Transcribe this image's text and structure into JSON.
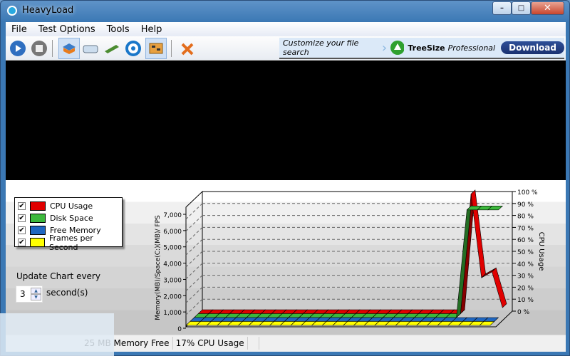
{
  "window": {
    "title": "HeavyLoad",
    "minimize": "–",
    "maximize": "□",
    "close": "✕"
  },
  "menu": [
    "File",
    "Test Options",
    "Tools",
    "Help"
  ],
  "toolbar": {
    "icons": [
      "play-icon",
      "stop-icon",
      "cpu-icon",
      "disk-icon",
      "memory-icon",
      "treesize-icon",
      "gpu-icon",
      "tools-icon"
    ],
    "active": [
      "cpu-icon",
      "gpu-icon"
    ]
  },
  "ad": {
    "text": "Customize your file search",
    "brand": "TreeSize",
    "brand_suffix": "Professional",
    "button": "Download"
  },
  "legend": [
    {
      "label": "CPU Usage",
      "color": "#e00000",
      "checked": true
    },
    {
      "label": "Disk Space",
      "color": "#3cb83c",
      "checked": true
    },
    {
      "label": "Free Memory",
      "color": "#1f66c0",
      "checked": true
    },
    {
      "label": "Frames per Second",
      "color": "#ffff00",
      "checked": true
    }
  ],
  "update": {
    "label": "Update Chart every",
    "value": "3",
    "unit": "second(s)"
  },
  "chart_data": {
    "type": "line",
    "3d": true,
    "left_axis": {
      "label": "Memory(MB)/Space(C:)(MB)/ FPS",
      "ticks": [
        "0",
        "1,000",
        "2,000",
        "3,000",
        "4,000",
        "5,000",
        "6,000",
        "7,000"
      ],
      "range": [
        0,
        7000
      ]
    },
    "right_axis": {
      "label": "CPU Usage",
      "ticks": [
        "0 %",
        "10 %",
        "20 %",
        "30 %",
        "40 %",
        "50 %",
        "60 %",
        "70 %",
        "80 %",
        "90 %",
        "100 %"
      ],
      "range": [
        0,
        100
      ]
    },
    "grid": true,
    "series": [
      {
        "name": "CPU Usage",
        "color": "#e00000",
        "values": [
          0,
          0,
          0,
          0,
          0,
          0,
          0,
          0,
          0,
          0,
          0,
          0,
          0,
          0,
          0,
          0,
          0,
          0,
          0,
          0,
          0,
          0,
          0,
          0,
          0,
          0,
          100,
          30,
          35,
          5
        ]
      },
      {
        "name": "Disk Space",
        "color": "#3cb83c",
        "values": [
          0,
          0,
          0,
          0,
          0,
          0,
          0,
          0,
          0,
          0,
          0,
          0,
          0,
          0,
          0,
          0,
          0,
          0,
          0,
          0,
          0,
          0,
          0,
          0,
          0,
          0,
          90,
          90,
          90,
          90
        ]
      },
      {
        "name": "Free Memory",
        "color": "#1f66c0",
        "values": [
          0,
          0,
          0,
          0,
          0,
          0,
          0,
          0,
          0,
          0,
          0,
          0,
          0,
          0,
          0,
          0,
          0,
          0,
          0,
          0,
          0,
          0,
          0,
          0,
          0,
          0,
          0,
          0,
          0,
          0
        ]
      },
      {
        "name": "Frames per Second",
        "color": "#ffff00",
        "values": [
          0,
          0,
          0,
          0,
          0,
          0,
          0,
          0,
          0,
          0,
          0,
          0,
          0,
          0,
          0,
          0,
          0,
          0,
          0,
          0,
          0,
          0,
          0,
          0,
          0,
          0,
          0,
          0,
          0,
          0
        ]
      }
    ]
  },
  "status": [
    "25 MB Memory Free",
    "17% CPU Usage",
    ""
  ]
}
